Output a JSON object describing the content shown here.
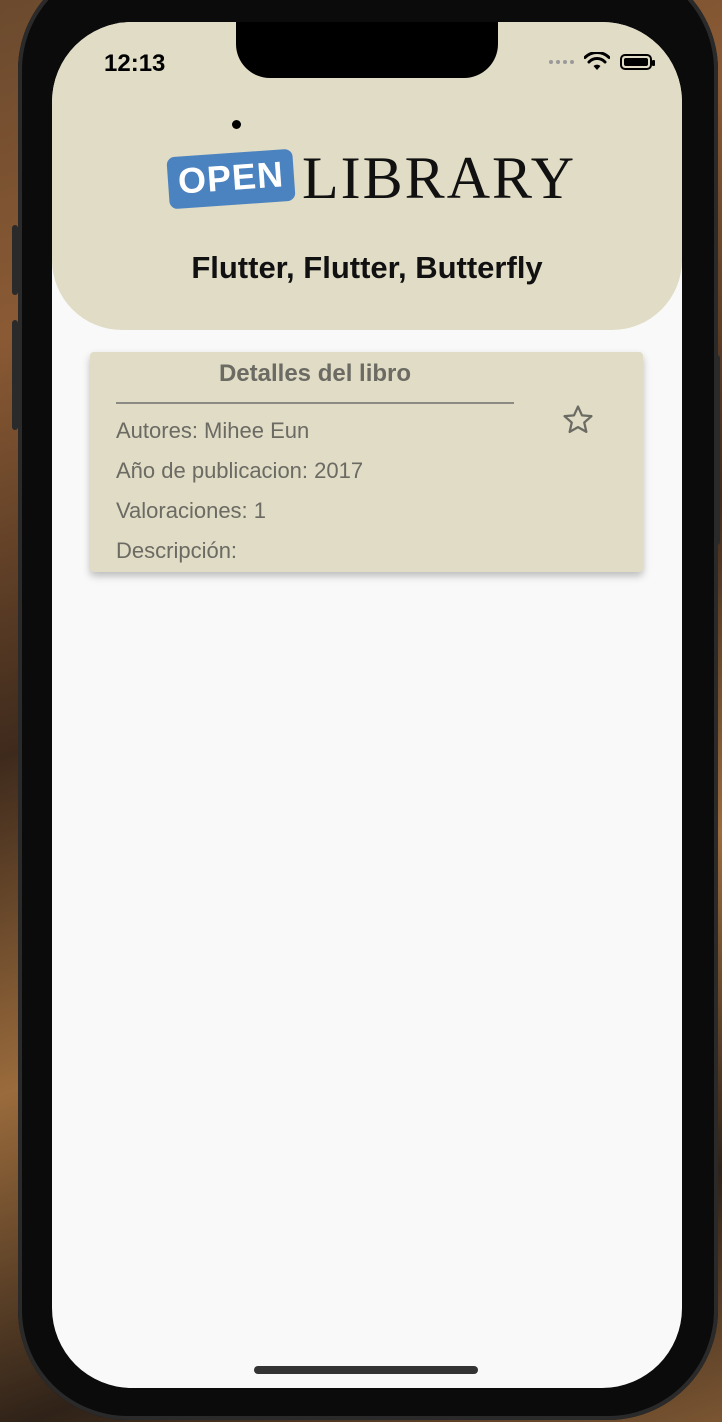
{
  "status_bar": {
    "time": "12:13"
  },
  "header": {
    "logo_open": "OPEN",
    "logo_library": "LIBRARY",
    "book_title": "Flutter, Flutter, Butterfly"
  },
  "details_card": {
    "title": "Detalles del libro",
    "authors": "Autores: Mihee Eun",
    "year": "Año de publicacion: 2017",
    "ratings": "Valoraciones: 1",
    "description": "Descripción:",
    "favorite_icon": "star-outline-icon"
  },
  "colors": {
    "header_bg": "#e0dcc5",
    "logo_blue": "#4b83c0",
    "card_text": "#6b6a63",
    "screen_bg": "#f9f9f9"
  }
}
